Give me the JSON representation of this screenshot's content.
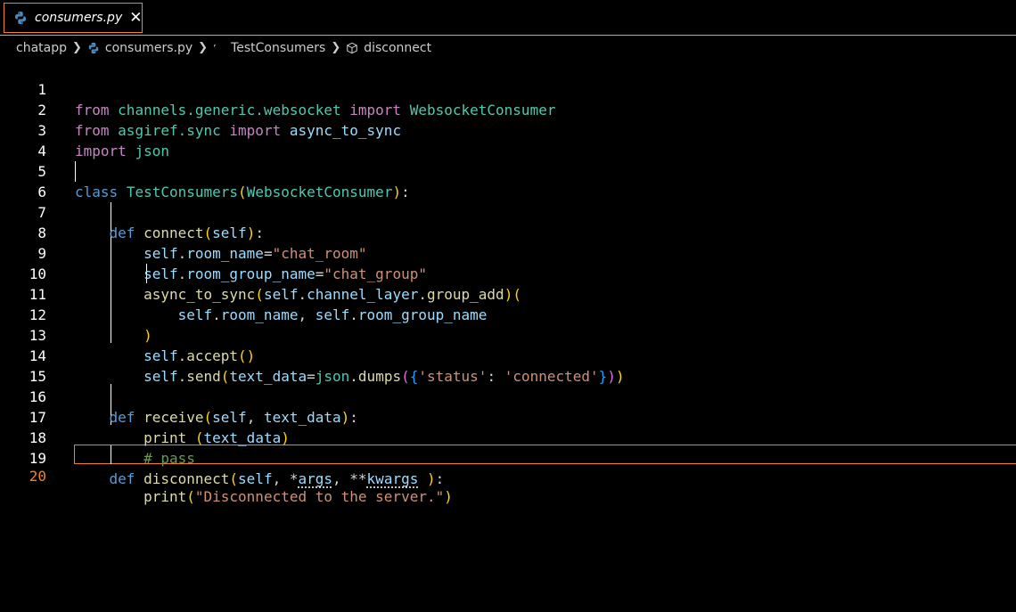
{
  "tab": {
    "label": "consumers.py",
    "close_glyph": "✕"
  },
  "breadcrumb": {
    "items": [
      "chatapp",
      "consumers.py",
      "TestConsumers",
      "disconnect"
    ],
    "separator": ">"
  },
  "editor": {
    "active_line": 20,
    "line_numbers": [
      "1",
      "2",
      "3",
      "4",
      "5",
      "6",
      "7",
      "8",
      "9",
      "10",
      "11",
      "12",
      "13",
      "14",
      "15",
      "16",
      "17",
      "18",
      "19",
      "20"
    ],
    "lines": [
      "from channels.generic.websocket import WebsocketConsumer",
      "from asgiref.sync import async_to_sync",
      "import json",
      "",
      "class TestConsumers(WebsocketConsumer):",
      "",
      "    def connect(self):",
      "        self.room_name=\"chat_room\"",
      "        self.room_group_name=\"chat_group\"",
      "        async_to_sync(self.channel_layer.group_add)(",
      "            self.room_name, self.room_group_name",
      "        )",
      "        self.accept()",
      "        self.send(text_data=json.dumps({'status': 'connected'}))",
      "",
      "    def receive(self, text_data):",
      "        print (text_data)",
      "        # pass",
      "    def disconnect(self, *args, **kwargs ):",
      "        print(\"Disconnected to the server.\")"
    ]
  },
  "colors": {
    "background": "#000000",
    "tab_border": "#f38518",
    "tabbar_border": "#6fc3df",
    "active_line_number": "#f38518"
  },
  "icons": {
    "tab_file_icon": "python-icon",
    "breadcrumb_file_icon": "python-icon",
    "breadcrumb_method_icon": "cube-icon"
  }
}
